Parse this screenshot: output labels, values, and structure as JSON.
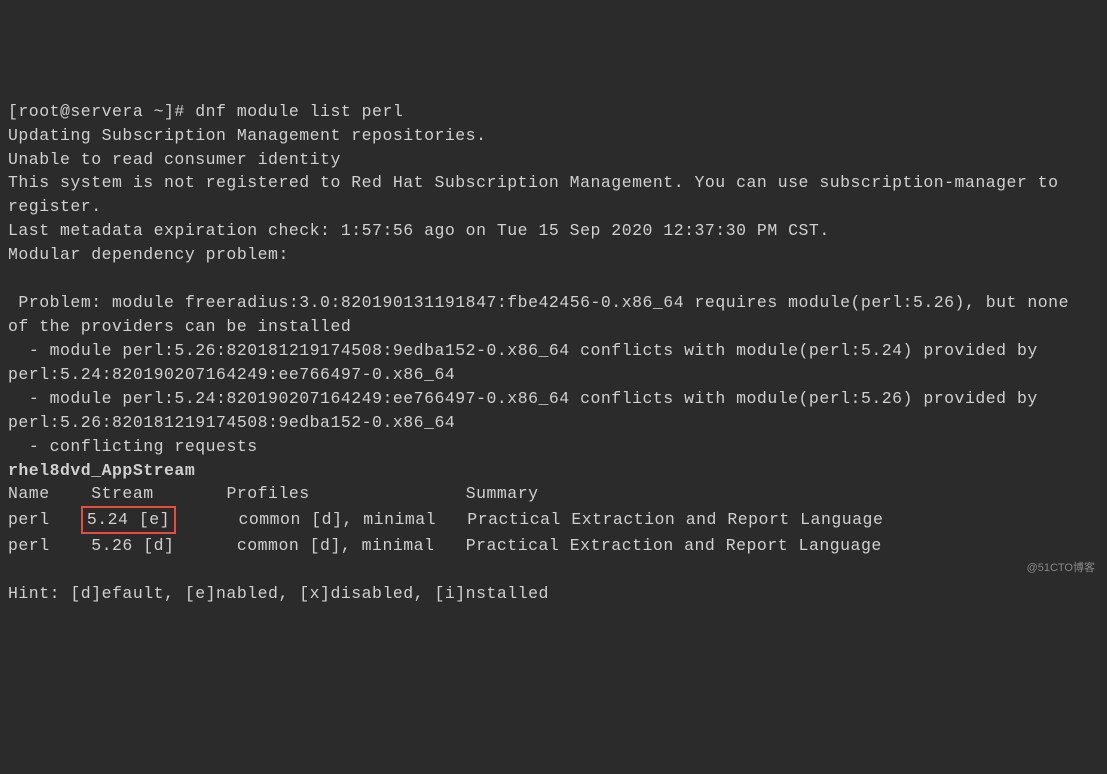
{
  "prompt": {
    "user_host": "[root@servera ~]# ",
    "command": "dnf module list perl"
  },
  "messages": {
    "updating": "Updating Subscription Management repositories.",
    "unable_read": "Unable to read consumer identity",
    "not_registered": "This system is not registered to Red Hat Subscription Management. You can use subscription-manager to register.",
    "metadata": "Last metadata expiration check: 1:57:56 ago on Tue 15 Sep 2020 12:37:30 PM CST.",
    "modular_problem": "Modular dependency problem:",
    "problem_line": " Problem: module freeradius:3.0:820190131191847:fbe42456-0.x86_64 requires module(perl:5.26), but none of the providers can be installed",
    "conflict1": "  - module perl:5.26:820181219174508:9edba152-0.x86_64 conflicts with module(perl:5.24) provided by perl:5.24:820190207164249:ee766497-0.x86_64",
    "conflict2": "  - module perl:5.24:820190207164249:ee766497-0.x86_64 conflicts with module(perl:5.26) provided by perl:5.26:820181219174508:9edba152-0.x86_64",
    "conflicting_requests": "  - conflicting requests",
    "repo_name": "rhel8dvd_AppStream",
    "hint": "Hint: [d]efault, [e]nabled, [x]disabled, [i]nstalled"
  },
  "table": {
    "headers": {
      "name": "Name",
      "stream": "Stream",
      "profiles": "Profiles",
      "summary": "Summary"
    },
    "rows": [
      {
        "name": "perl",
        "stream": "5.24 [e]",
        "profiles": "common [d], minimal",
        "summary": "Practical Extraction and Report Language",
        "highlighted": true
      },
      {
        "name": "perl",
        "stream": "5.26 [d]",
        "profiles": "common [d], minimal",
        "summary": "Practical Extraction and Report Language",
        "highlighted": false
      }
    ]
  },
  "watermark": "@51CTO博客"
}
